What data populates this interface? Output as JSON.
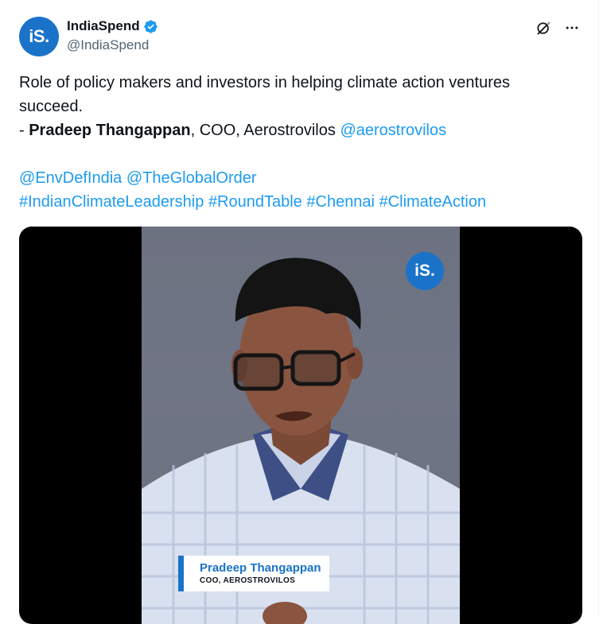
{
  "author": {
    "display_name": "IndiaSpend",
    "handle": "@IndiaSpend",
    "avatar_text": "iS.",
    "verified": true
  },
  "icons": {
    "grok": "grok-icon",
    "more": "more-icon",
    "verified": "verified-badge-icon"
  },
  "tweet": {
    "line1": "Role of policy makers and investors in helping climate action ventures succeed.",
    "dash": "- ",
    "speaker_name": "Pradeep Thangappan",
    "speaker_role": ", COO, Aerostrovilos ",
    "speaker_mention": "@aerostrovilos",
    "mention1": "@EnvDefIndia",
    "mention2": "@TheGlobalOrder",
    "hashtag1": "#IndianClimateLeadership",
    "hashtag2": "#RoundTable",
    "hashtag3": "#Chennai",
    "hashtag4": "#ClimateAction"
  },
  "video": {
    "logo_text": "iS.",
    "nameplate_name": "Pradeep Thangappan",
    "nameplate_title": "COO, AEROSTROVILOS"
  },
  "colors": {
    "link": "#1d9bf0",
    "brand": "#1a73c8",
    "text": "#0f1419",
    "muted": "#536471"
  }
}
